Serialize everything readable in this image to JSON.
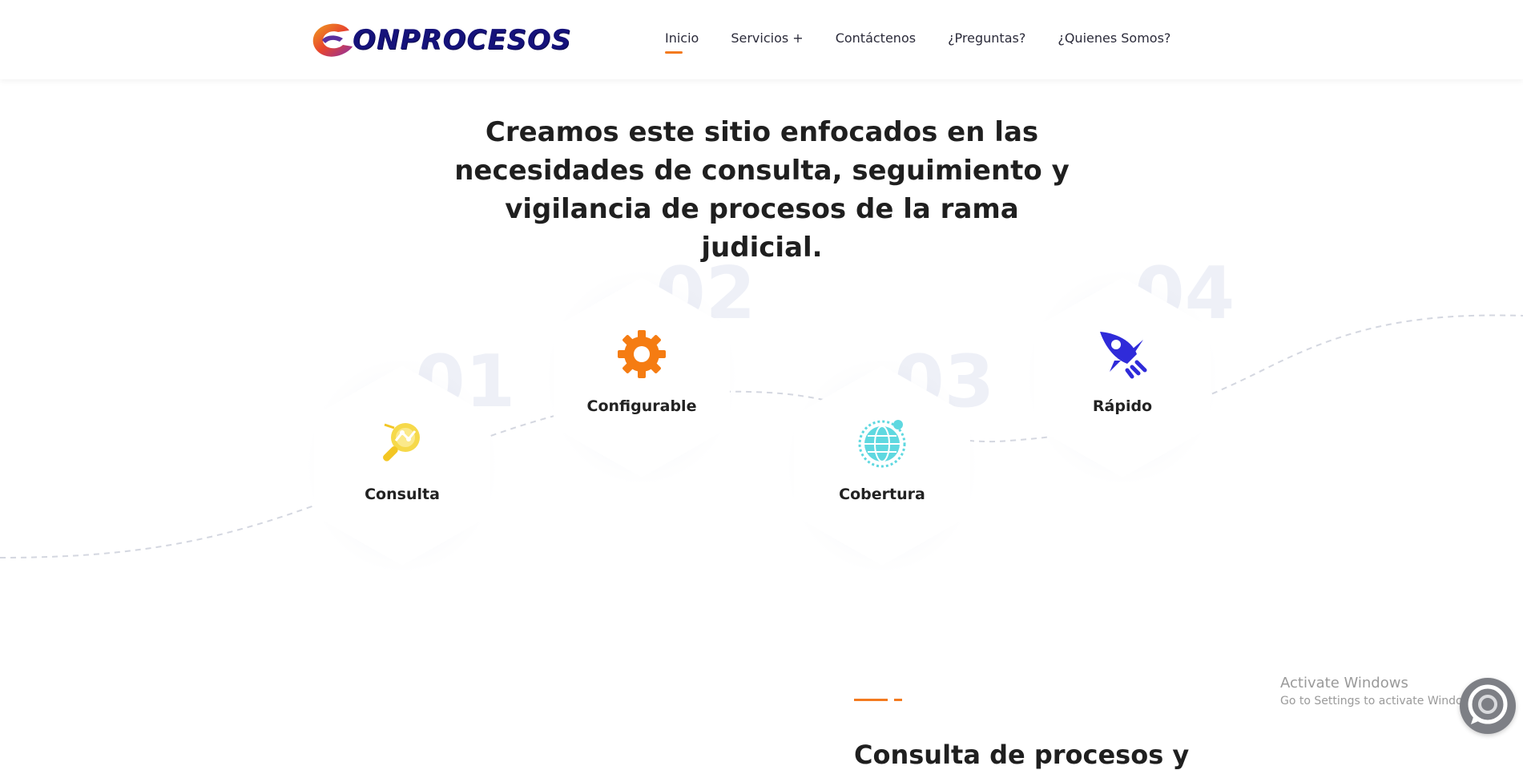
{
  "brand": {
    "name": "ONPROCESOS",
    "logo_icon": "c-swirl-logo-icon",
    "text_color": "#15127a"
  },
  "nav": {
    "items": [
      {
        "label": "Inicio",
        "active": true
      },
      {
        "label": "Servicios +",
        "active": false
      },
      {
        "label": "Contáctenos",
        "active": false
      },
      {
        "label": "¿Preguntas?",
        "active": false
      },
      {
        "label": "¿Quienes Somos?",
        "active": false
      }
    ],
    "accent_color": "#f37a1f"
  },
  "hero": {
    "headline_line1": "Creamos este sitio enfocados en las",
    "headline_line2": "necesidades de consulta, seguimiento y",
    "headline_line3": "vigilancia de procesos de la rama judicial."
  },
  "features": [
    {
      "number": "01",
      "label": "Consulta",
      "icon": "magnifier-chart-icon",
      "color": "#f6d94a"
    },
    {
      "number": "02",
      "label": "Configurable",
      "icon": "gear-icon",
      "color": "#f57c12"
    },
    {
      "number": "03",
      "label": "Cobertura",
      "icon": "globe-icon",
      "color": "#5fd8e0"
    },
    {
      "number": "04",
      "label": "Rápido",
      "icon": "rocket-icon",
      "color": "#2f2bd9"
    }
  ],
  "section2": {
    "title": "Consulta de procesos y"
  },
  "os_watermark": {
    "line1": "Activate Windows",
    "line2": "Go to Settings to activate Windows."
  },
  "chat": {
    "icon": "chat-bubble-icon"
  }
}
